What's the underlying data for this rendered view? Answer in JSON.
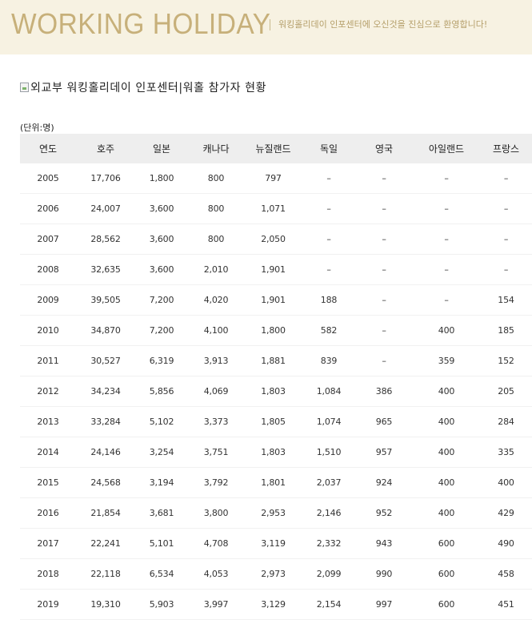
{
  "banner": {
    "title": "WORKING HOLIDAY",
    "subtitle": "워킹홀리데이 인포센터에 오신것을 진심으로 환영합니다!"
  },
  "heading": {
    "text": "외교부 워킹홀리데이 인포센터|워홀 참가자 현황"
  },
  "unit_label": "(단위:명)",
  "table": {
    "columns": [
      "연도",
      "호주",
      "일본",
      "캐나다",
      "뉴질랜드",
      "독일",
      "영국",
      "아일랜드",
      "프랑스"
    ],
    "rows": [
      [
        "2005",
        "17,706",
        "1,800",
        "800",
        "797",
        "–",
        "–",
        "–",
        "–"
      ],
      [
        "2006",
        "24,007",
        "3,600",
        "800",
        "1,071",
        "–",
        "–",
        "–",
        "–"
      ],
      [
        "2007",
        "28,562",
        "3,600",
        "800",
        "2,050",
        "–",
        "–",
        "–",
        "–"
      ],
      [
        "2008",
        "32,635",
        "3,600",
        "2,010",
        "1,901",
        "–",
        "–",
        "–",
        "–"
      ],
      [
        "2009",
        "39,505",
        "7,200",
        "4,020",
        "1,901",
        "188",
        "–",
        "–",
        "154"
      ],
      [
        "2010",
        "34,870",
        "7,200",
        "4,100",
        "1,800",
        "582",
        "–",
        "400",
        "185"
      ],
      [
        "2011",
        "30,527",
        "6,319",
        "3,913",
        "1,881",
        "839",
        "–",
        "359",
        "152"
      ],
      [
        "2012",
        "34,234",
        "5,856",
        "4,069",
        "1,803",
        "1,084",
        "386",
        "400",
        "205"
      ],
      [
        "2013",
        "33,284",
        "5,102",
        "3,373",
        "1,805",
        "1,074",
        "965",
        "400",
        "284"
      ],
      [
        "2014",
        "24,146",
        "3,254",
        "3,751",
        "1,803",
        "1,510",
        "957",
        "400",
        "335"
      ],
      [
        "2015",
        "24,568",
        "3,194",
        "3,792",
        "1,801",
        "2,037",
        "924",
        "400",
        "400"
      ],
      [
        "2016",
        "21,854",
        "3,681",
        "3,800",
        "2,953",
        "2,146",
        "952",
        "400",
        "429"
      ],
      [
        "2017",
        "22,241",
        "5,101",
        "4,708",
        "3,119",
        "2,332",
        "943",
        "600",
        "490"
      ],
      [
        "2018",
        "22,118",
        "6,534",
        "4,053",
        "2,973",
        "2,099",
        "990",
        "600",
        "458"
      ],
      [
        "2019",
        "19,310",
        "5,903",
        "3,997",
        "3,129",
        "2,154",
        "997",
        "600",
        "451"
      ]
    ]
  }
}
